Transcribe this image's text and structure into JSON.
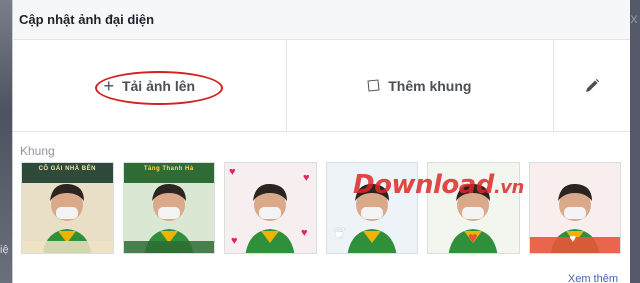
{
  "dialog": {
    "title": "Cập nhật ảnh đại diện",
    "close_glyph": "x"
  },
  "actions": {
    "upload_label": "Tải ảnh lên",
    "frame_label": "Thêm khung",
    "upload_icon": "plus-icon",
    "frame_icon": "square-frame-icon",
    "edit_icon": "pencil-icon"
  },
  "frames_section": {
    "label": "Khung",
    "items": [
      {
        "caption": "CÔ GÁI NHÀ BÊN"
      },
      {
        "caption": "Tăng Thanh Hà"
      },
      {
        "caption": ""
      },
      {
        "caption": ""
      },
      {
        "caption": ""
      },
      {
        "caption": ""
      }
    ],
    "see_more": "Xem thêm"
  },
  "watermark": {
    "text": "Download",
    "suffix": ".vn"
  },
  "backdrop": {
    "peek_text": "iệ"
  },
  "colors": {
    "highlight_ring": "#d32020",
    "link": "#4267b2",
    "watermark": "#dc2828"
  }
}
